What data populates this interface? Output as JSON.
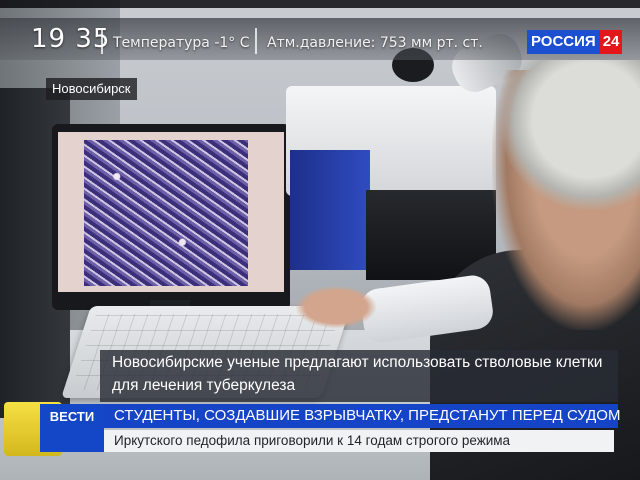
{
  "header": {
    "time": "19 35",
    "temperature": "Температура -1° С",
    "pressure": "Атм.давление: 753 мм рт. ст.",
    "channel": {
      "name": "РОССИЯ",
      "number": "24"
    }
  },
  "location": "Новосибирск",
  "caption": {
    "line1": "Новосибирские ученые предлагают использовать стволовые клетки",
    "line2": "для лечения туберкулеза"
  },
  "ticker": {
    "brand": "ВЕСТИ",
    "headline": "СТУДЕНТЫ, СОЗДАВШИЕ ВЗРЫВЧАТКУ, ПРЕДСТАНУТ ПЕРЕД СУДОМ",
    "subline": "Иркутского педофила приговорили к 14 годам строгого режима"
  },
  "colors": {
    "channel_blue": "#1d4fd1",
    "channel_red": "#e3161b",
    "ticker_blue": "#1644c6",
    "ticker_sub_bg": "#f1f2f4"
  },
  "icons": [
    "rossiya-24-logo"
  ]
}
